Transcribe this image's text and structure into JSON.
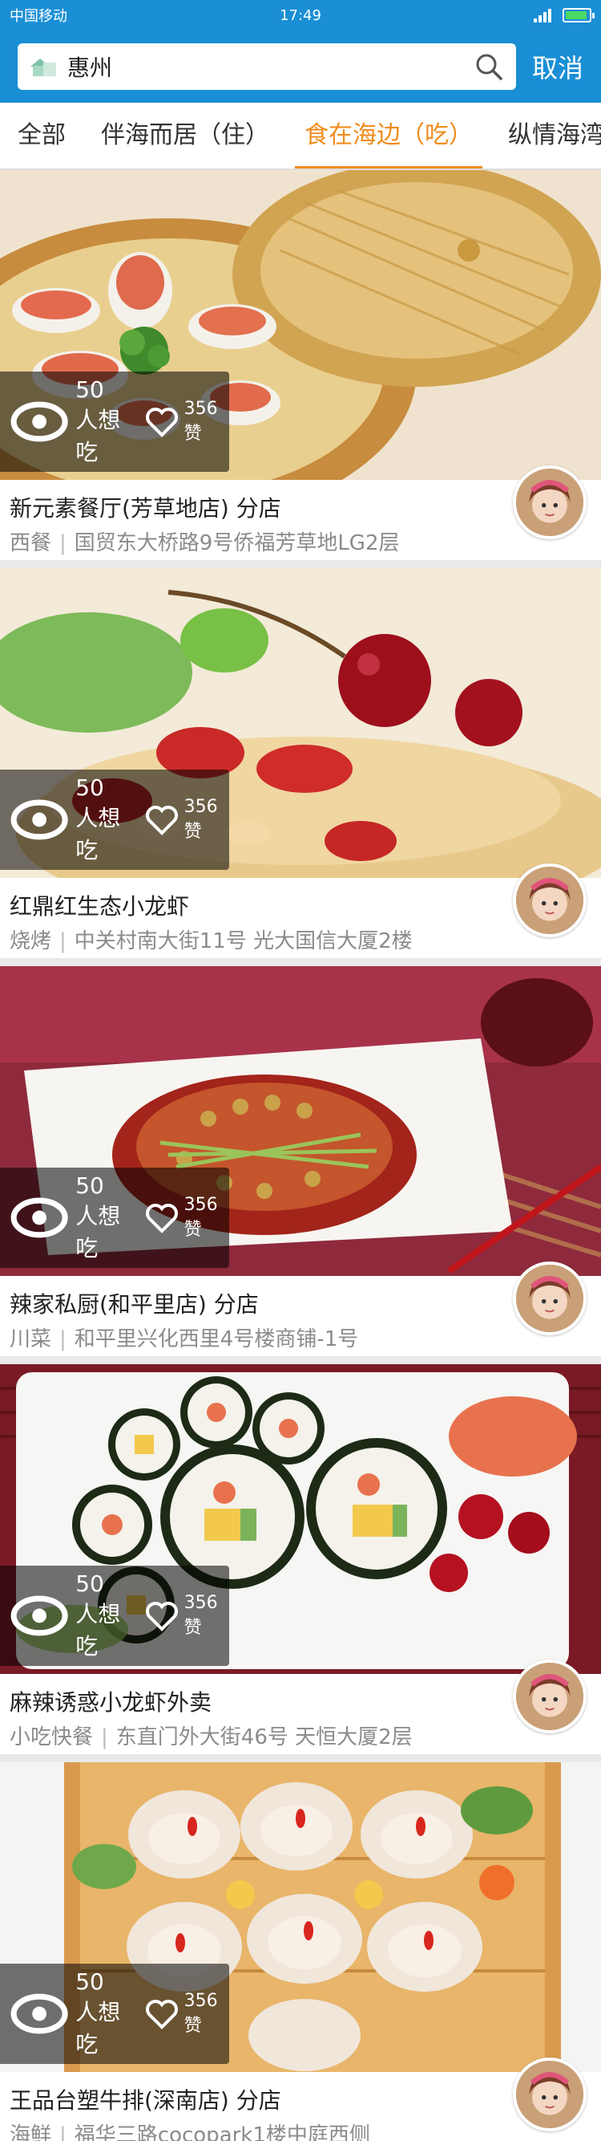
{
  "status_bar": {
    "carrier": "中国移动",
    "time": "17:49"
  },
  "search": {
    "value": "惠州",
    "cancel_label": "取消"
  },
  "tabs": [
    {
      "label": "全部"
    },
    {
      "label": "伴海而居（住）"
    },
    {
      "label": "食在海边（吃）",
      "active": true
    },
    {
      "label": "纵情海湾"
    }
  ],
  "restaurants": [
    {
      "name": "新元素餐厅(芳草地店) 分店",
      "category": "西餐",
      "address": "国贸东大桥路9号侨福芳草地LG2层",
      "want": "50人想吃",
      "likes": "356赞",
      "photo": "dim-sum-steamer"
    },
    {
      "name": "红鼎红生态小龙虾",
      "category": "烧烤",
      "address": "中关村南大街11号 光大国信大厦2楼",
      "want": "50人想吃",
      "likes": "356赞",
      "photo": "cherry-dessert"
    },
    {
      "name": "辣家私厨(和平里店) 分店",
      "category": "川菜",
      "address": "和平里兴化西里4号楼商铺-1号",
      "want": "50人想吃",
      "likes": "356赞",
      "photo": "spicy-noodles"
    },
    {
      "name": "麻辣诱惑小龙虾外卖",
      "category": "小吃快餐",
      "address": "东直门外大街46号 天恒大厦2层",
      "want": "50人想吃",
      "likes": "356赞",
      "photo": "sushi-rolls"
    },
    {
      "name": "王品台塑牛排(深南店) 分店",
      "category": "海鲜",
      "address": "福华三路cocopark1楼中庭西侧",
      "want": "50人想吃",
      "likes": "356赞",
      "photo": "scallops"
    }
  ],
  "colors": {
    "brand_blue": "#1a8fd5",
    "active_tab": "#f08c1e"
  }
}
